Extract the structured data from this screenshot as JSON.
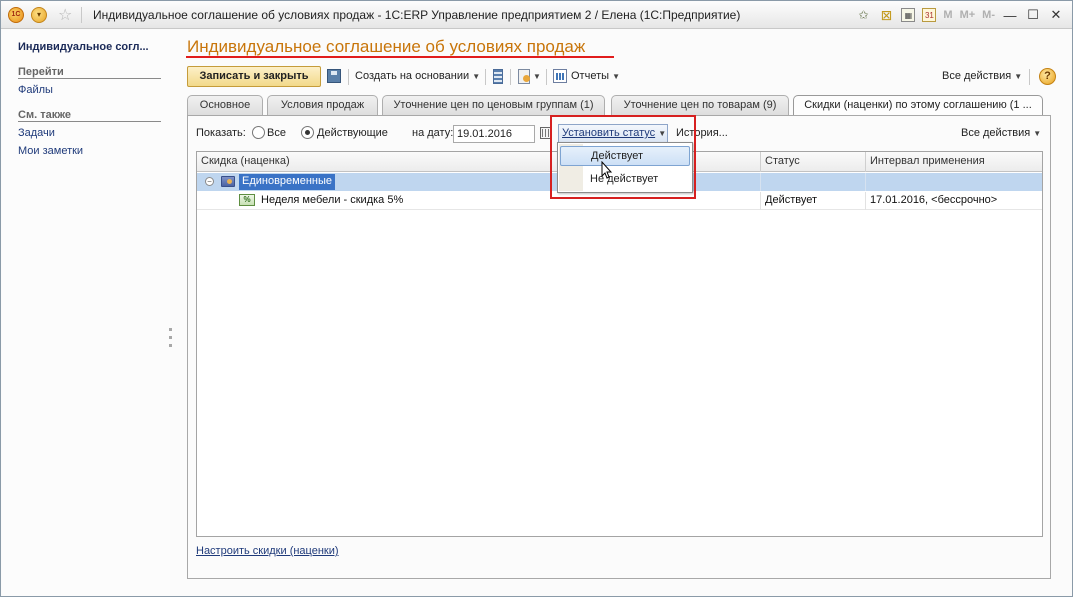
{
  "window": {
    "title": "Индивидуальное соглашение об условиях продаж - 1С:ERP Управление предприятием 2 / Елена  (1С:Предприятие)",
    "logo_text": "1C",
    "toolbar_right": {
      "m": "M",
      "m_plus": "M+",
      "m_minus": "M-"
    }
  },
  "left_panel": {
    "title": "Индивидуальное согл...",
    "sections": [
      {
        "header": "Перейти",
        "links": [
          "Файлы"
        ]
      },
      {
        "header": "См. также",
        "links": [
          "Задачи",
          "Мои заметки"
        ]
      }
    ]
  },
  "form": {
    "title": "Индивидуальное соглашение об условиях продаж",
    "toolbar": {
      "save_close": "Записать и закрыть",
      "create_based": "Создать на основании",
      "reports": "Отчеты",
      "all_actions": "Все действия",
      "help": "?"
    },
    "tabs": [
      "Основное",
      "Условия продаж",
      "Уточнение цен по ценовым группам (1)",
      "Уточнение цен по товарам (9)",
      "Скидки (наценки) по этому соглашению (1 ..."
    ],
    "filter": {
      "show_label": "Показать:",
      "option_all": "Все",
      "option_active": "Действующие",
      "date_label": "на дату:",
      "date_value": "19.01.2016",
      "set_status": "Установить статус",
      "history": "История...",
      "all_actions": "Все действия"
    },
    "grid": {
      "columns": [
        "Скидка (наценка)",
        "Статус",
        "Интервал применения"
      ],
      "group_row": {
        "name": "Единовременные"
      },
      "rows": [
        {
          "name": "Неделя мебели - скидка 5%",
          "status": "Действует",
          "interval": "17.01.2016, <бессрочно>"
        }
      ]
    },
    "bottom_link": "Настроить скидки (наценки)",
    "dropdown": {
      "items": [
        "Действует",
        "Не действует"
      ]
    }
  },
  "colors": {
    "title_orange": "#c8750a",
    "title_underline": "#e11c1c",
    "highlight_frame": "#d62020",
    "group_row_bg": "#bfd6ef",
    "selected_label_bg": "#3a73c6"
  }
}
